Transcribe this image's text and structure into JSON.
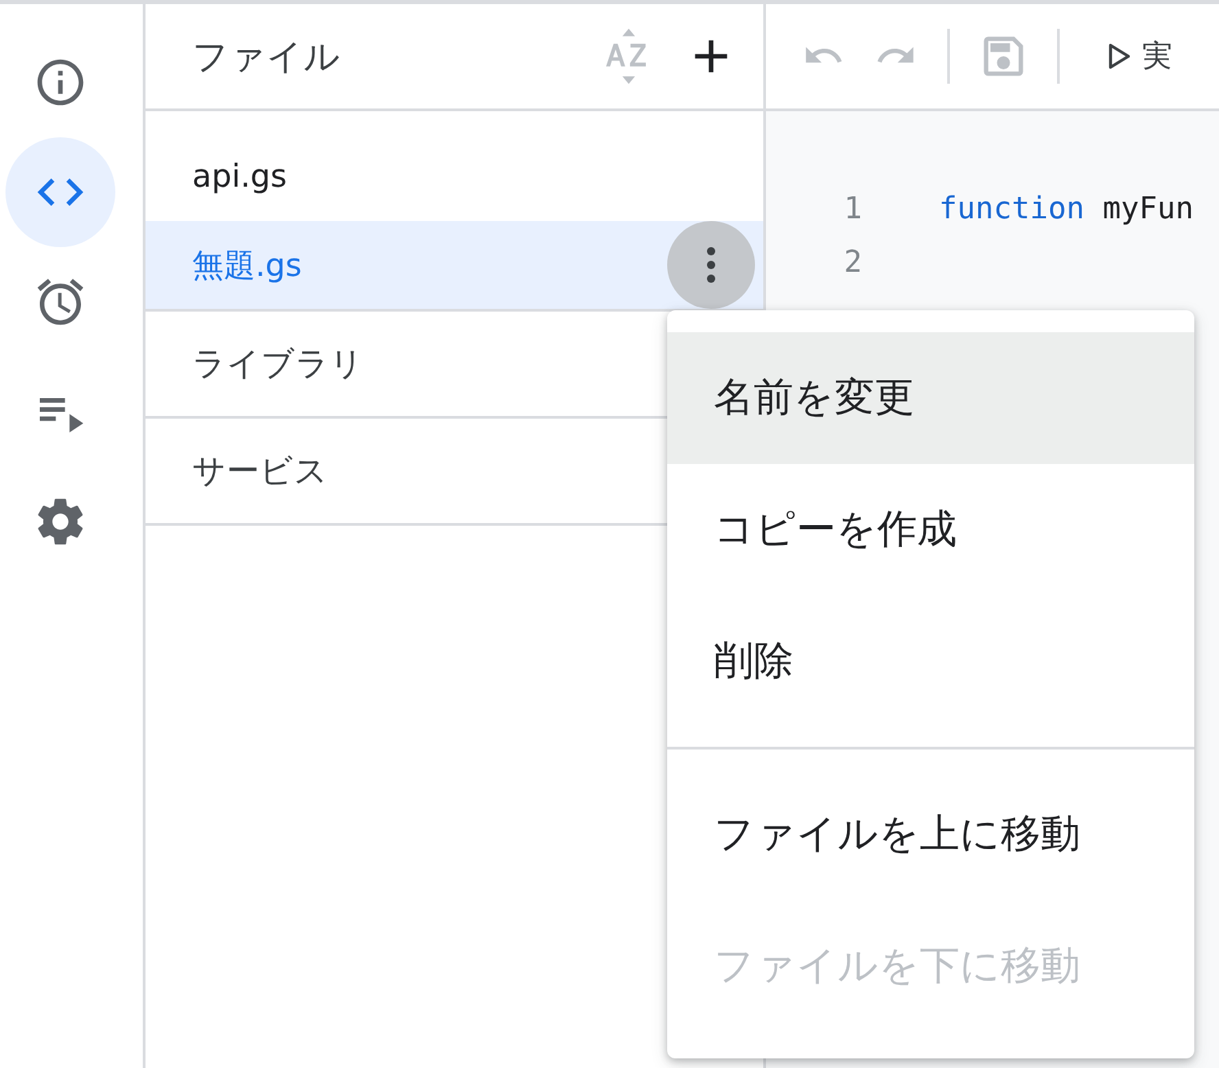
{
  "rail": [
    {
      "kind": "info",
      "selected": false
    },
    {
      "kind": "code",
      "selected": true
    },
    {
      "kind": "alarm",
      "selected": false
    },
    {
      "kind": "playlist",
      "selected": false
    },
    {
      "kind": "settings",
      "selected": false
    }
  ],
  "files_panel": {
    "title": "ファイル",
    "files": [
      {
        "name": "api.gs",
        "selected": false
      },
      {
        "name": "無題.gs",
        "selected": true
      }
    ],
    "sections": [
      "ライブラリ",
      "サービス"
    ]
  },
  "toolbar": {
    "run_label": "実"
  },
  "editor": {
    "lines": [
      {
        "number": "1",
        "keyword": "function",
        "text": " myFun"
      },
      {
        "number": "2"
      }
    ]
  },
  "context_menu": {
    "items": [
      {
        "label": "名前を変更",
        "highlighted": true,
        "disabled": false,
        "divider_before": false
      },
      {
        "label": "コピーを作成",
        "highlighted": false,
        "disabled": false,
        "divider_before": false
      },
      {
        "label": "削除",
        "highlighted": false,
        "disabled": false,
        "divider_before": false
      },
      {
        "label": "ファイルを上に移動",
        "highlighted": false,
        "disabled": false,
        "divider_before": true
      },
      {
        "label": "ファイルを下に移動",
        "highlighted": false,
        "disabled": true,
        "divider_before": false
      }
    ]
  }
}
